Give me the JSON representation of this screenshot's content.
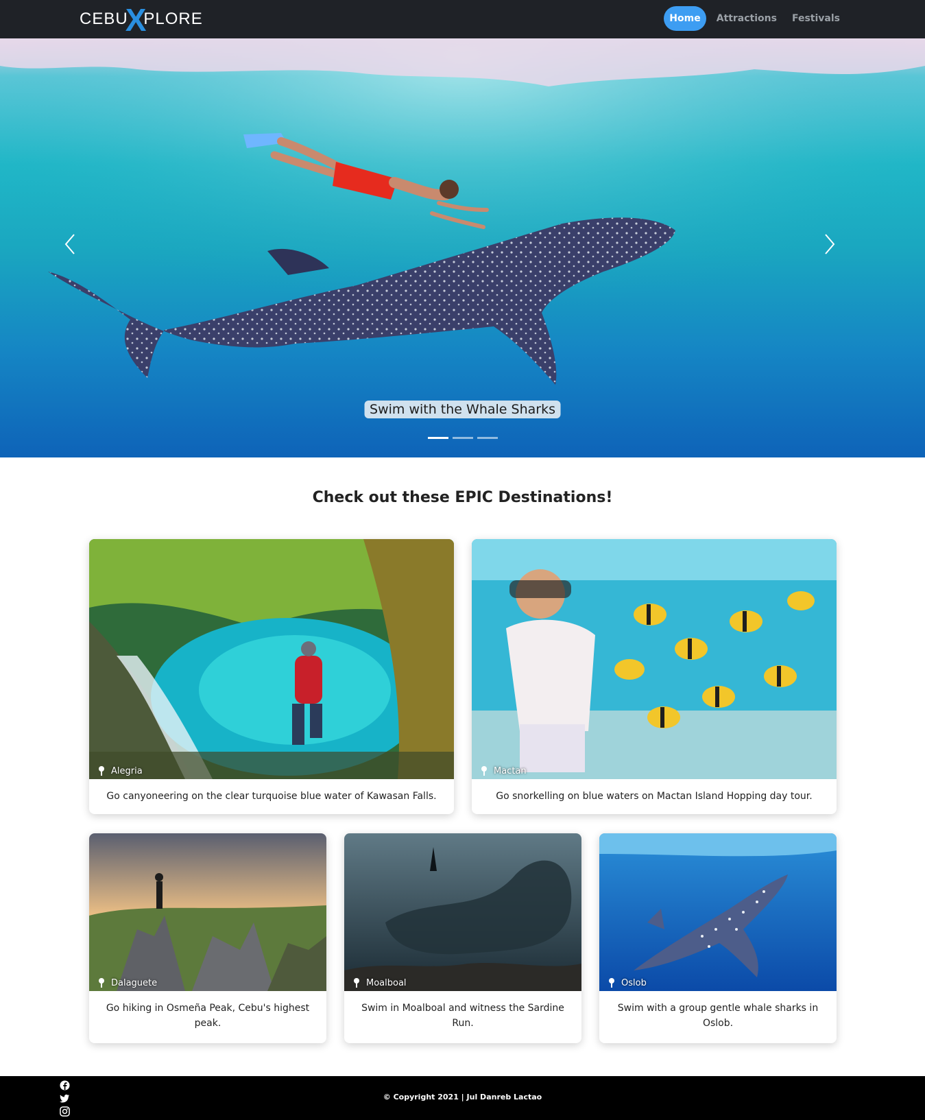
{
  "header": {
    "brand_left": "CEBU",
    "brand_x": "X",
    "brand_right": "PLORE",
    "nav": [
      {
        "label": "Home",
        "active": true
      },
      {
        "label": "Attractions",
        "active": false
      },
      {
        "label": "Festivals",
        "active": false
      }
    ]
  },
  "hero": {
    "caption": "Swim with the Whale Sharks",
    "slides_total": 3,
    "active_slide": 1
  },
  "main": {
    "title": "Check out these EPIC Destinations!",
    "cards": [
      {
        "location": "Alegria",
        "description": "Go canyoneering on the clear turquoise blue water of Kawasan Falls."
      },
      {
        "location": "Mactan",
        "description": "Go snorkelling on blue waters on Mactan Island Hopping day tour."
      },
      {
        "location": "Dalaguete",
        "description": "Go hiking in Osmeña Peak, Cebu's highest peak."
      },
      {
        "location": "Moalboal",
        "description": "Swim in Moalboal and witness the Sardine Run."
      },
      {
        "location": "Oslob",
        "description": "Swim with a group gentle whale sharks in Oslob."
      }
    ]
  },
  "footer": {
    "copyright": "© Copyright 2021 | Jul Danreb Lactao",
    "social": [
      "facebook-icon",
      "twitter-icon",
      "instagram-icon"
    ]
  },
  "colors": {
    "navbar_bg": "#1f2227",
    "nav_active": "#3d9df2",
    "brand_accent": "#2a8fe0",
    "footer_bg": "#000000"
  }
}
